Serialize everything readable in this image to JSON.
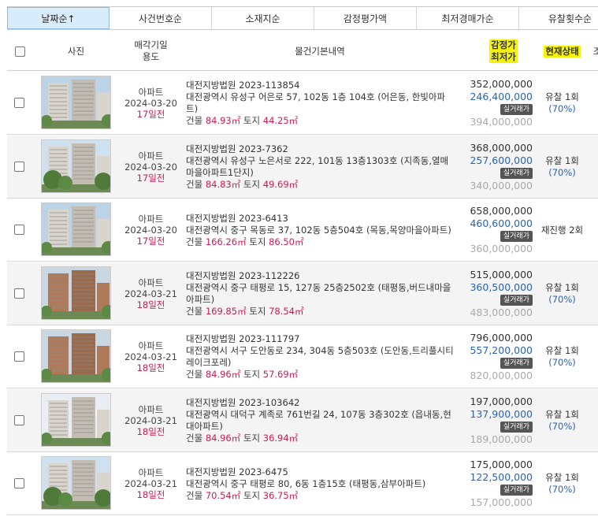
{
  "sort_tabs": [
    {
      "label": "날짜순↑",
      "active": true
    },
    {
      "label": "사건번호순",
      "active": false
    },
    {
      "label": "소재지순",
      "active": false
    },
    {
      "label": "감정평가액",
      "active": false
    },
    {
      "label": "최저경매가순",
      "active": false
    },
    {
      "label": "유찰횟수순",
      "active": false
    }
  ],
  "headers": {
    "photo": "사진",
    "date_use_1": "매각기일",
    "date_use_2": "용도",
    "info": "물건기본내역",
    "price_1": "감정가",
    "price_2": "최저가",
    "status": "현재상태",
    "extra": "조"
  },
  "labels": {
    "real_price_badge": "실거래가",
    "building": "건물",
    "land": "토지"
  },
  "listings": [
    {
      "use": "아파트",
      "date": "2024-03-20",
      "days": "17일전",
      "court_case": "대전지방법원 2023-113854",
      "address": "대전광역시 유성구 어은로 57, 102동 1층 104호 (어은동, 한빛아파트)",
      "building_area": "84.93㎡",
      "land_area": "44.25㎡",
      "appraisal": "352,000,000",
      "minimum": "246,400,000",
      "real_price": "394,000,000",
      "status": "유찰 1회",
      "percent": "(70%)",
      "photo_theme": "tall"
    },
    {
      "use": "아파트",
      "date": "2024-03-20",
      "days": "17일전",
      "court_case": "대전지방법원 2023-7362",
      "address": "대전광역시 유성구 노은서로 222, 101동 13층1303호 (지족동,열매마을아파트1단지)",
      "building_area": "84.83㎡",
      "land_area": "49.69㎡",
      "appraisal": "368,000,000",
      "minimum": "257,600,000",
      "real_price": "340,000,000",
      "status": "유찰 1회",
      "percent": "(70%)",
      "photo_theme": "trees"
    },
    {
      "use": "아파트",
      "date": "2024-03-20",
      "days": "17일전",
      "court_case": "대전지방법원 2023-6413",
      "address": "대전광역시 중구 목동로 37, 102동 5층504호 (목동,목양마을아파트)",
      "building_area": "166.26㎡",
      "land_area": "86.50㎡",
      "appraisal": "658,000,000",
      "minimum": "460,600,000",
      "real_price": "360,000,000",
      "status": "재진행 2회",
      "percent": "",
      "photo_theme": "tall"
    },
    {
      "use": "아파트",
      "date": "2024-03-21",
      "days": "18일전",
      "court_case": "대전지방법원 2023-112226",
      "address": "대전광역시 중구 태평로 15, 127동 25층2502호 (태평동,버드내마을아파트)",
      "building_area": "169.85㎡",
      "land_area": "78.54㎡",
      "appraisal": "515,000,000",
      "minimum": "360,500,000",
      "real_price": "483,000,000",
      "status": "유찰 1회",
      "percent": "(70%)",
      "photo_theme": "brown"
    },
    {
      "use": "아파트",
      "date": "2024-03-21",
      "days": "18일전",
      "court_case": "대전지방법원 2023-111797",
      "address": "대전광역시 서구 도안동로 234, 304동 5층503호 (도안동,트리풀시티레이크포레)",
      "building_area": "84.96㎡",
      "land_area": "57.69㎡",
      "appraisal": "796,000,000",
      "minimum": "557,200,000",
      "real_price": "820,000,000",
      "status": "유찰 1회",
      "percent": "(70%)",
      "photo_theme": "brown"
    },
    {
      "use": "아파트",
      "date": "2024-03-21",
      "days": "18일전",
      "court_case": "대전지방법원 2023-103642",
      "address": "대전광역시 대덕구 계족로 761번길 24, 107동 3층302호 (읍내동,현대아파트)",
      "building_area": "84.96㎡",
      "land_area": "36.94㎡",
      "appraisal": "197,000,000",
      "minimum": "137,900,000",
      "real_price": "189,000,000",
      "status": "유찰 1회",
      "percent": "(70%)",
      "photo_theme": "sun"
    },
    {
      "use": "아파트",
      "date": "2024-03-21",
      "days": "18일전",
      "court_case": "대전지방법원 2023-6475",
      "address": "대전광역시 중구 태평로 80, 6동 1층15호 (태평동,삼부아파트)",
      "building_area": "70.54㎡",
      "land_area": "36.75㎡",
      "appraisal": "175,000,000",
      "minimum": "122,500,000",
      "real_price": "157,000,000",
      "status": "유찰 1회",
      "percent": "(70%)",
      "photo_theme": "trees"
    }
  ]
}
